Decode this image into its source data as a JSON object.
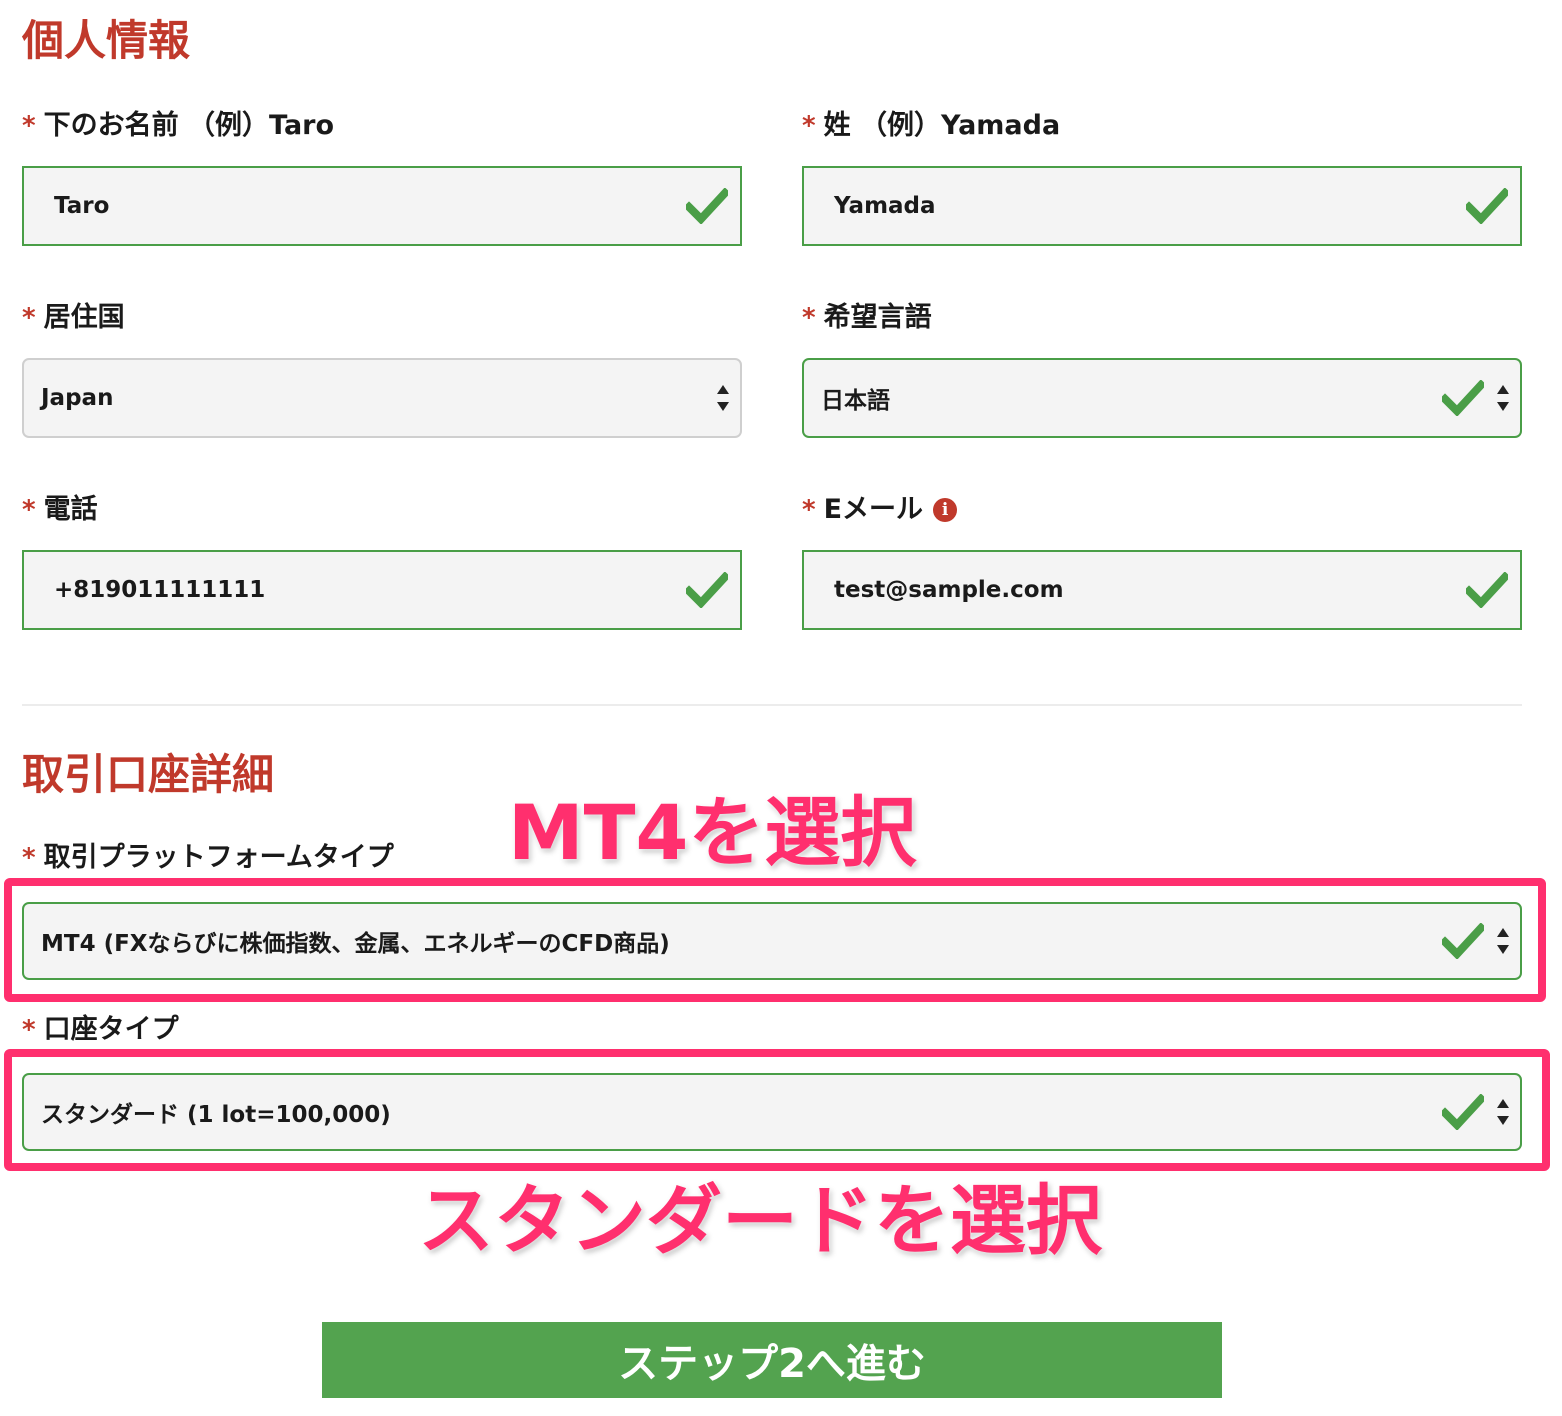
{
  "colors": {
    "heading": "#c0392b",
    "required_star": "#c0392b",
    "valid_border": "#4a9e47",
    "annotation": "#ff2f6e",
    "submit_button": "#53a34f"
  },
  "personal": {
    "title": "個人情報",
    "required_marker": "*",
    "first_name": {
      "label": "下のお名前 （例）Taro",
      "value": "Taro",
      "icon": "check-icon"
    },
    "last_name": {
      "label": "姓 （例）Yamada",
      "value": "Yamada",
      "icon": "check-icon"
    },
    "country": {
      "label": "居住国",
      "value": "Japan"
    },
    "language": {
      "label": "希望言語",
      "value": "日本語",
      "icon": "check-icon"
    },
    "phone": {
      "label": "電話",
      "value": "+819011111111",
      "icon": "check-icon"
    },
    "email": {
      "label": "Eメール",
      "info_icon": "i",
      "value": "test@sample.com",
      "icon": "check-icon"
    }
  },
  "account": {
    "title": "取引口座詳細",
    "platform": {
      "label": "取引プラットフォームタイプ",
      "value": "MT4 (FXならびに株価指数、金属、エネルギーのCFD商品)",
      "icon": "check-icon"
    },
    "account_type": {
      "label": "口座タイプ",
      "value": "スタンダード (1 lot=100,000)",
      "icon": "check-icon"
    }
  },
  "annotations": {
    "platform_note": "MT4を選択",
    "account_type_note": "スタンダードを選択"
  },
  "submit": {
    "label": "ステップ2へ進む"
  }
}
